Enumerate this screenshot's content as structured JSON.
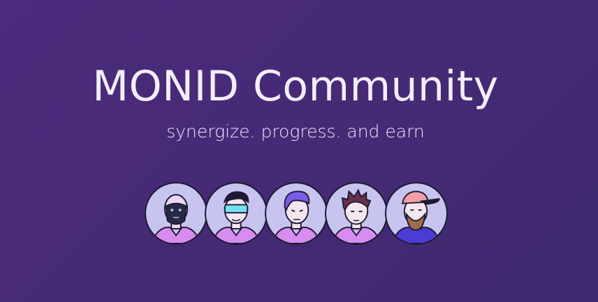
{
  "hero": {
    "title": "MONID Community",
    "subtitle": "synergize. progress. and earn"
  },
  "colors": {
    "background": "#452a75",
    "text": "#f4eefb",
    "avatar_bg": "#c7c4f0",
    "shirt_pink": "#d88cf2",
    "outline": "#1f1a33"
  },
  "avatars": [
    {
      "icon": "masked-avatar-icon"
    },
    {
      "icon": "visor-avatar-icon"
    },
    {
      "icon": "purple-hair-avatar-icon"
    },
    {
      "icon": "spiky-hair-avatar-icon"
    },
    {
      "icon": "cap-beard-avatar-icon"
    }
  ]
}
